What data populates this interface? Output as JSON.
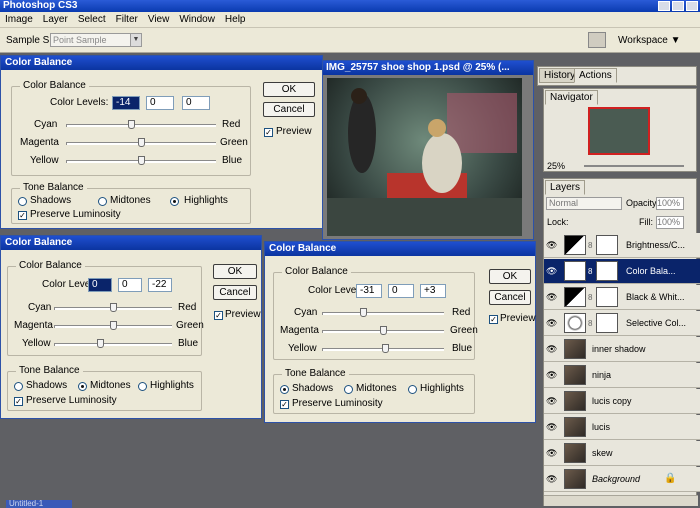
{
  "app": {
    "title": "Photoshop CS3"
  },
  "menu": [
    "Image",
    "Layer",
    "Select",
    "Filter",
    "View",
    "Window",
    "Help"
  ],
  "options_bar": {
    "sample_size_label": "Sample Size:",
    "sample_size_value": "Point Sample",
    "workspace_label": "Workspace ▼"
  },
  "dialogs": [
    {
      "title": "Color Balance",
      "color_balance_group": "Color Balance",
      "levels_label": "Color Levels:",
      "levels": [
        "-14",
        "0",
        "0"
      ],
      "rows": [
        {
          "left": "Cyan",
          "right": "Red"
        },
        {
          "left": "Magenta",
          "right": "Green"
        },
        {
          "left": "Yellow",
          "right": "Blue"
        }
      ],
      "slider_positions": [
        0.43,
        0.5,
        0.5
      ],
      "tone_group": "Tone Balance",
      "tones": [
        "Shadows",
        "Midtones",
        "Highlights"
      ],
      "tone_selected": 2,
      "preserve": "Preserve Luminosity",
      "ok": "OK",
      "cancel": "Cancel",
      "preview": "Preview"
    },
    {
      "title": "Color Balance",
      "color_balance_group": "Color Balance",
      "levels_label": "Color Levels:",
      "levels": [
        "0",
        "0",
        "-22"
      ],
      "rows": [
        {
          "left": "Cyan",
          "right": "Red"
        },
        {
          "left": "Magenta",
          "right": "Green"
        },
        {
          "left": "Yellow",
          "right": "Blue"
        }
      ],
      "slider_positions": [
        0.5,
        0.5,
        0.39
      ],
      "tone_group": "Tone Balance",
      "tones": [
        "Shadows",
        "Midtones",
        "Highlights"
      ],
      "tone_selected": 1,
      "preserve": "Preserve Luminosity",
      "ok": "OK",
      "cancel": "Cancel",
      "preview": "Preview"
    },
    {
      "title": "Color Balance",
      "color_balance_group": "Color Balance",
      "levels_label": "Color Levels:",
      "levels": [
        "-31",
        "0",
        "+3"
      ],
      "rows": [
        {
          "left": "Cyan",
          "right": "Red"
        },
        {
          "left": "Magenta",
          "right": "Green"
        },
        {
          "left": "Yellow",
          "right": "Blue"
        }
      ],
      "slider_positions": [
        0.34,
        0.5,
        0.52
      ],
      "tone_group": "Tone Balance",
      "tones": [
        "Shadows",
        "Midtones",
        "Highlights"
      ],
      "tone_selected": 0,
      "preserve": "Preserve Luminosity",
      "ok": "OK",
      "cancel": "Cancel",
      "preview": "Preview"
    }
  ],
  "document": {
    "title": "IMG_25757 shoe shop 1.psd @ 25% (..."
  },
  "history_panel": {
    "tabs": [
      "History",
      "Actions"
    ]
  },
  "navigator": {
    "tab": "Navigator",
    "zoom": "25%"
  },
  "layers_panel": {
    "tab": "Layers",
    "blend_mode": "Normal",
    "opacity_label": "Opacity:",
    "opacity": "100%",
    "lock_label": "Lock:",
    "fill_label": "Fill:",
    "fill": "100%",
    "layers": [
      {
        "name": "Brightness/C...",
        "type": "adjustment",
        "selected": false
      },
      {
        "name": "Color Bala...",
        "type": "adjustment",
        "selected": true
      },
      {
        "name": "Black & Whit...",
        "type": "adjustment",
        "selected": false
      },
      {
        "name": "Selective Col...",
        "type": "adjustment",
        "selected": false
      },
      {
        "name": "inner shadow",
        "type": "pixel",
        "selected": false
      },
      {
        "name": "ninja",
        "type": "pixel",
        "selected": false
      },
      {
        "name": "lucis copy",
        "type": "pixel",
        "selected": false
      },
      {
        "name": "lucis",
        "type": "pixel",
        "selected": false
      },
      {
        "name": "skew",
        "type": "pixel",
        "selected": false
      },
      {
        "name": "Background",
        "type": "pixel",
        "selected": false
      }
    ]
  },
  "taskbar": {
    "minimized_label": "Untitled-1"
  }
}
